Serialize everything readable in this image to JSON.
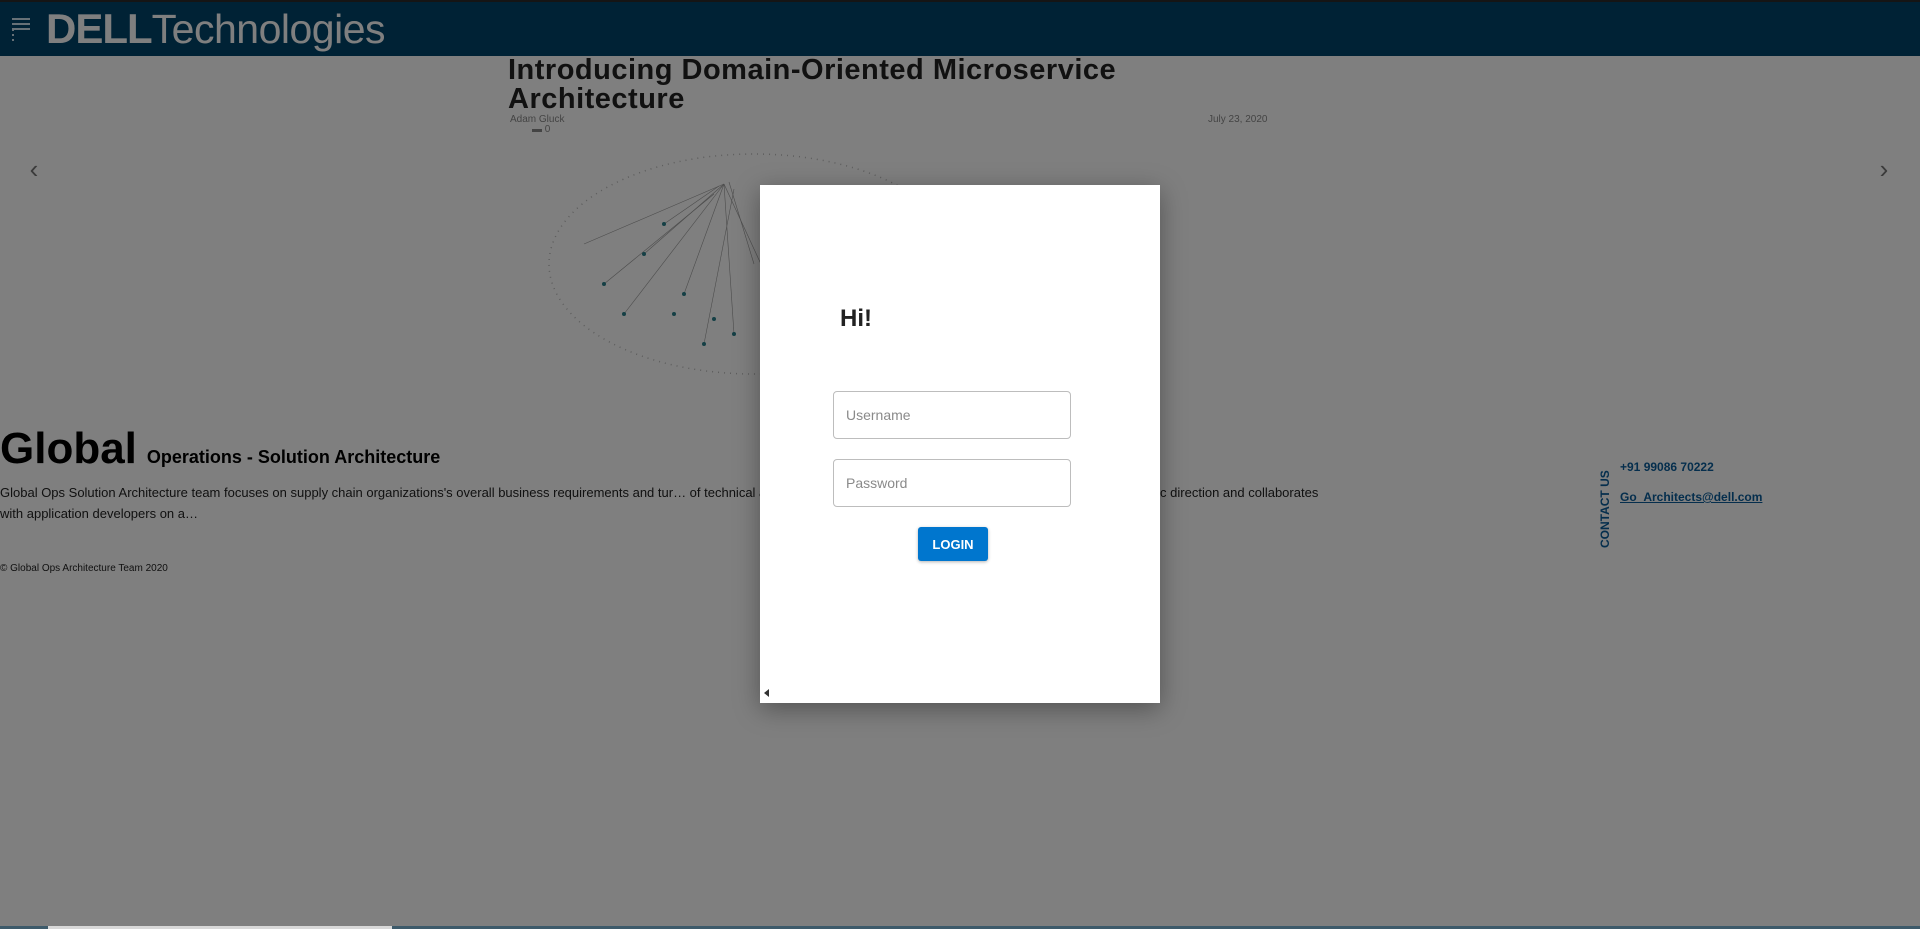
{
  "header": {
    "logo_dell": "DELL",
    "logo_technologies": "Technologies"
  },
  "carousel": {
    "prev_arrow": "‹",
    "next_arrow": "›",
    "slide": {
      "title": "Introducing Domain-Oriented Microservice Architecture",
      "author": "Adam Gluck",
      "date": "July 23, 2020",
      "comments": "0"
    }
  },
  "about": {
    "title_big": "Global",
    "title_sub": "Operations - Solution Architecture",
    "description": "Global Ops Solution Architecture team focuses on supply chain organizations's overall business requirements and tur… of technical and business skills, ofter work with an enterprise architect for stratergic direction and collaborates with application developers on a…",
    "copyright": "© Global Ops Architecture Team 2020"
  },
  "contact": {
    "label": "CONTACT US",
    "phone": "+91 99086 70222",
    "email": "Go_Architects@dell.com"
  },
  "login_modal": {
    "greeting": "Hi!",
    "username_placeholder": "Username",
    "password_placeholder": "Password",
    "login_label": "LOGIN"
  },
  "colors": {
    "header_bg": "#00446b",
    "accent_blue": "#0076ce",
    "contact_blue": "#0a5d9a"
  }
}
